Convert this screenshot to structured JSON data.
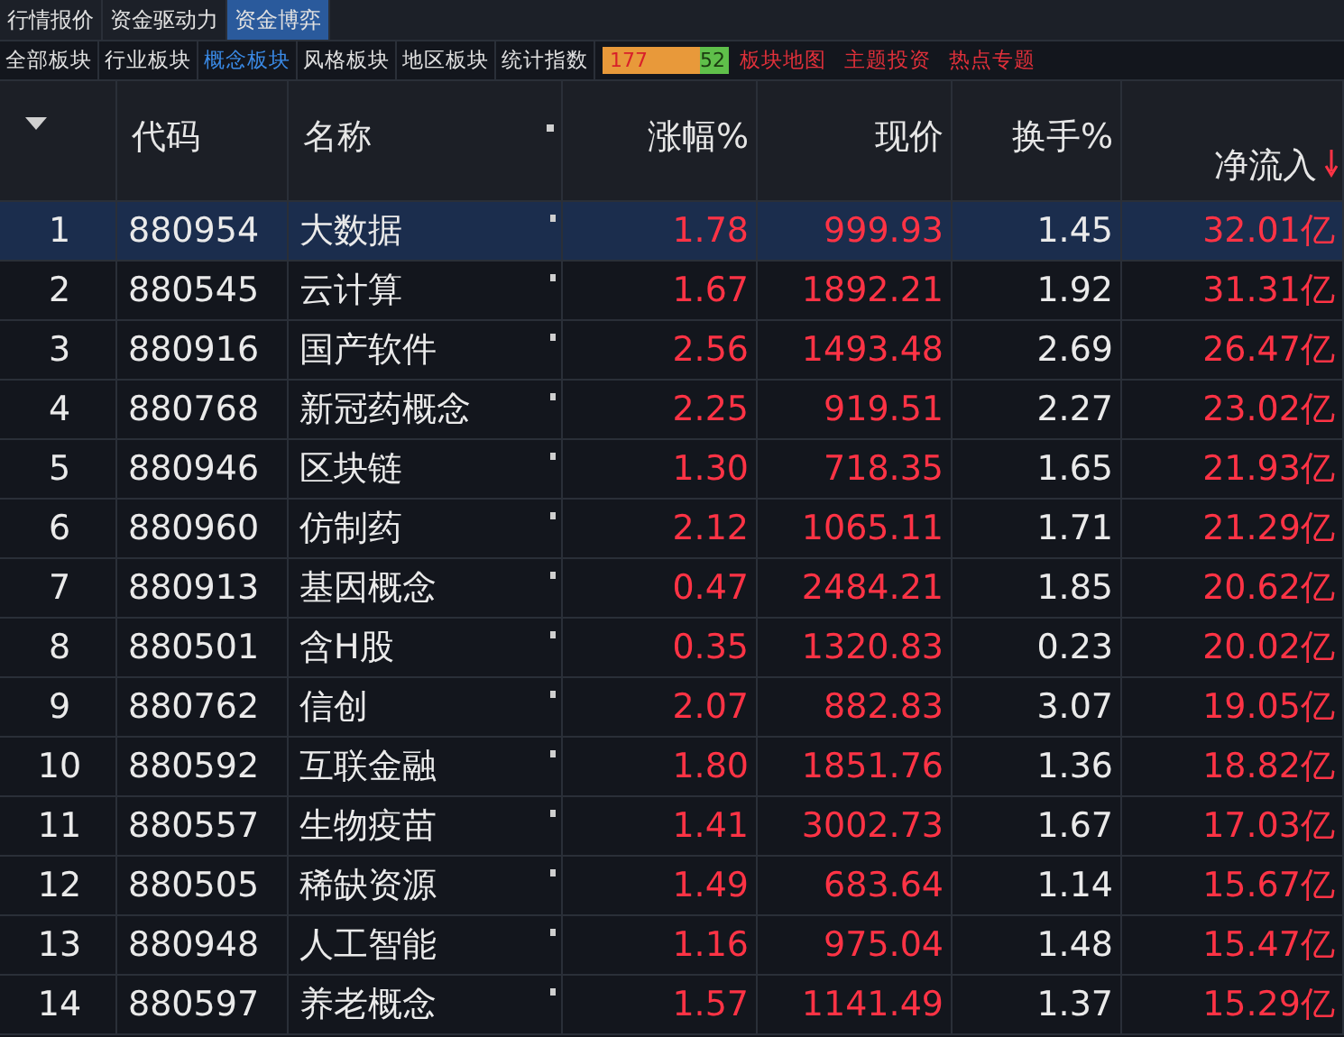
{
  "top_tabs": [
    {
      "label": "行情报价",
      "selected": false
    },
    {
      "label": "资金驱动力",
      "selected": false
    },
    {
      "label": "资金博弈",
      "selected": true
    }
  ],
  "sub_tabs": [
    {
      "label": "全部板块",
      "selected": false
    },
    {
      "label": "行业板块",
      "selected": false
    },
    {
      "label": "概念板块",
      "selected": true
    },
    {
      "label": "风格板块",
      "selected": false
    },
    {
      "label": "地区板块",
      "selected": false
    },
    {
      "label": "统计指数",
      "selected": false
    }
  ],
  "breadth": {
    "up": "177",
    "down": "52",
    "level": 0.78
  },
  "links": [
    "板块地图",
    "主题投资",
    "热点专题"
  ],
  "table": {
    "columns": [
      "代码",
      "名称",
      "涨幅%",
      "现价",
      "换手%",
      "净流入"
    ],
    "rows": [
      {
        "index": "1",
        "code": "880954",
        "name": "大数据",
        "change": "1.78",
        "price": "999.93",
        "turnover": "1.45",
        "inflow": "32.01亿",
        "selected": true
      },
      {
        "index": "2",
        "code": "880545",
        "name": "云计算",
        "change": "1.67",
        "price": "1892.21",
        "turnover": "1.92",
        "inflow": "31.31亿",
        "selected": false
      },
      {
        "index": "3",
        "code": "880916",
        "name": "国产软件",
        "change": "2.56",
        "price": "1493.48",
        "turnover": "2.69",
        "inflow": "26.47亿",
        "selected": false
      },
      {
        "index": "4",
        "code": "880768",
        "name": "新冠药概念",
        "change": "2.25",
        "price": "919.51",
        "turnover": "2.27",
        "inflow": "23.02亿",
        "selected": false
      },
      {
        "index": "5",
        "code": "880946",
        "name": "区块链",
        "change": "1.30",
        "price": "718.35",
        "turnover": "1.65",
        "inflow": "21.93亿",
        "selected": false
      },
      {
        "index": "6",
        "code": "880960",
        "name": "仿制药",
        "change": "2.12",
        "price": "1065.11",
        "turnover": "1.71",
        "inflow": "21.29亿",
        "selected": false
      },
      {
        "index": "7",
        "code": "880913",
        "name": "基因概念",
        "change": "0.47",
        "price": "2484.21",
        "turnover": "1.85",
        "inflow": "20.62亿",
        "selected": false
      },
      {
        "index": "8",
        "code": "880501",
        "name": "含H股",
        "change": "0.35",
        "price": "1320.83",
        "turnover": "0.23",
        "inflow": "20.02亿",
        "selected": false
      },
      {
        "index": "9",
        "code": "880762",
        "name": "信创",
        "change": "2.07",
        "price": "882.83",
        "turnover": "3.07",
        "inflow": "19.05亿",
        "selected": false
      },
      {
        "index": "10",
        "code": "880592",
        "name": "互联金融",
        "change": "1.80",
        "price": "1851.76",
        "turnover": "1.36",
        "inflow": "18.82亿",
        "selected": false
      },
      {
        "index": "11",
        "code": "880557",
        "name": "生物疫苗",
        "change": "1.41",
        "price": "3002.73",
        "turnover": "1.67",
        "inflow": "17.03亿",
        "selected": false
      },
      {
        "index": "12",
        "code": "880505",
        "name": "稀缺资源",
        "change": "1.49",
        "price": "683.64",
        "turnover": "1.14",
        "inflow": "15.67亿",
        "selected": false
      },
      {
        "index": "13",
        "code": "880948",
        "name": "人工智能",
        "change": "1.16",
        "price": "975.04",
        "turnover": "1.48",
        "inflow": "15.47亿",
        "selected": false
      },
      {
        "index": "14",
        "code": "880597",
        "name": "养老概念",
        "change": "1.57",
        "price": "1141.49",
        "turnover": "1.37",
        "inflow": "15.29亿",
        "selected": false
      }
    ]
  }
}
